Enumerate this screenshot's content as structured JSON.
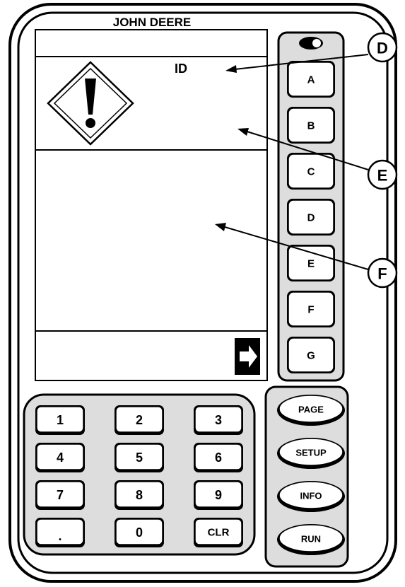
{
  "device": {
    "brand": "JOHN DEERE"
  },
  "screen": {
    "id_label": "ID"
  },
  "side_keys": [
    "A",
    "B",
    "C",
    "D",
    "E",
    "F",
    "G"
  ],
  "keypad": [
    "1",
    "2",
    "3",
    "4",
    "5",
    "6",
    "7",
    "8",
    "9",
    ".",
    "0",
    "CLR"
  ],
  "mode_keys": [
    "PAGE",
    "SETUP",
    "INFO",
    "RUN"
  ],
  "callouts": [
    "D",
    "E",
    "F"
  ],
  "icons": {
    "warning": "warning-diamond-icon",
    "next": "arrow-right-icon",
    "toggle": "contrast-toggle-icon"
  }
}
